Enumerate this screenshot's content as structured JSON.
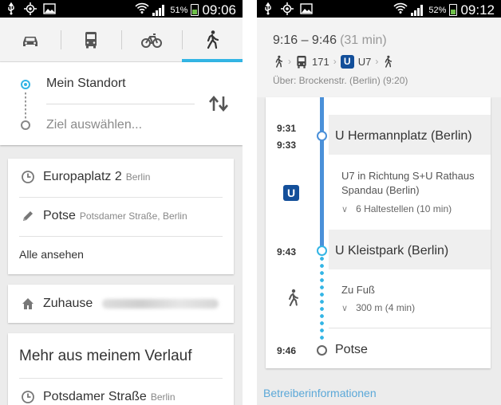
{
  "left": {
    "status": {
      "battery_pct": "51%",
      "time": "09:06"
    },
    "modes": [
      {
        "name": "car",
        "icon": "car-icon"
      },
      {
        "name": "transit",
        "icon": "bus-icon"
      },
      {
        "name": "bike",
        "icon": "bike-icon"
      },
      {
        "name": "walk",
        "icon": "walk-icon",
        "active": true
      }
    ],
    "route": {
      "origin": "Mein Standort",
      "destination_placeholder": "Ziel auswählen..."
    },
    "history": [
      {
        "icon": "clock-icon",
        "title": "Europaplatz 2",
        "subtitle": "Berlin"
      },
      {
        "icon": "pencil-icon",
        "title": "Potse",
        "subtitle": "Potsdamer Straße, Berlin"
      }
    ],
    "see_all": "Alle ansehen",
    "home": {
      "icon": "home-icon",
      "label": "Zuhause"
    },
    "more": {
      "title": "Mehr aus meinem Verlauf",
      "item": {
        "icon": "clock-icon",
        "title": "Potsdamer Straße",
        "subtitle": "Berlin"
      }
    }
  },
  "right": {
    "status": {
      "battery_pct": "52%",
      "time": "09:12"
    },
    "summary": {
      "time_range": "9:16 – 9:46",
      "duration": "(31 min)",
      "bus_number": "171",
      "ubahn_badge": "U",
      "ubahn_line": "U7",
      "via": "Über: Brockenstr. (Berlin) (9:20)"
    },
    "timeline": {
      "stop1": {
        "arrival": "9:31",
        "departure": "9:33",
        "name": "U Hermannplatz (Berlin)"
      },
      "transit_leg": {
        "badge": "U",
        "direction": "U7 in Richtung S+U Rathaus Spandau (Berlin)",
        "stops": "6 Haltestellen (10 min)"
      },
      "stop2": {
        "time": "9:43",
        "name": "U Kleistpark (Berlin)"
      },
      "walk_leg": {
        "label": "Zu Fuß",
        "distance": "300 m (4 min)"
      },
      "stop3": {
        "time": "9:46",
        "name": "Potse"
      }
    },
    "operator_link": "Betreiberinformationen"
  },
  "colors": {
    "accent": "#33b5e5",
    "transit_line": "#4a90d9",
    "ubahn": "#134f9a",
    "link": "#5ba8d8"
  }
}
